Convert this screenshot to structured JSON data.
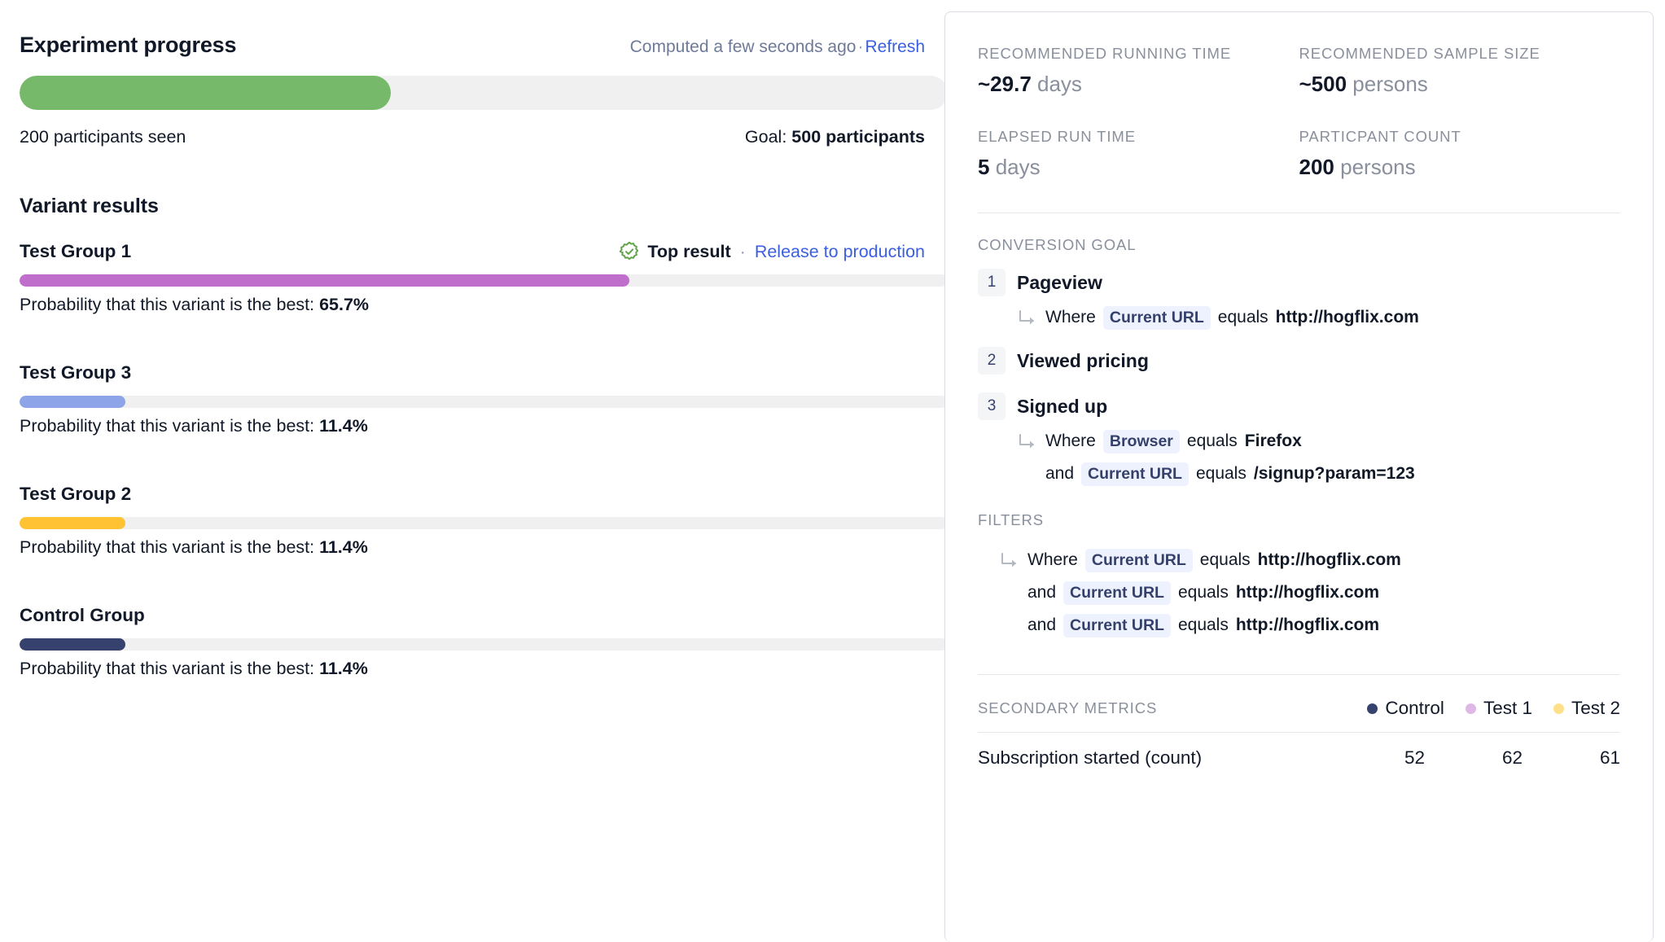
{
  "left": {
    "progress_title": "Experiment progress",
    "computed_text": "Computed a few seconds ago",
    "separator": "·",
    "refresh_label": "Refresh",
    "progress_percent": 40,
    "progress_color": "#77b96b",
    "participants_seen": "200 participants seen",
    "goal_prefix": "Goal: ",
    "goal_value": "500 participants",
    "variant_results_title": "Variant results",
    "top_result_label": "Top result",
    "top_result_separator": "·",
    "release_label": "Release to production",
    "prob_prefix": "Probability that this variant is the best: ",
    "variants": [
      {
        "name": "Test Group 1",
        "probability": "65.7%",
        "percent": 65.7,
        "color": "#bf6ecb",
        "top": true
      },
      {
        "name": "Test Group 3",
        "probability": "11.4%",
        "percent": 11.4,
        "color": "#8da5e8",
        "top": false
      },
      {
        "name": "Test Group 2",
        "probability": "11.4%",
        "percent": 11.4,
        "color": "#ffc233",
        "top": false
      },
      {
        "name": "Control Group",
        "probability": "11.4%",
        "percent": 11.4,
        "color": "#36416e",
        "top": false
      }
    ]
  },
  "right": {
    "metrics": [
      {
        "label": "Recommended running time",
        "value": "~29.7",
        "unit": "days"
      },
      {
        "label": "Recommended sample size",
        "value": "~500",
        "unit": "persons"
      },
      {
        "label": "Elapsed run time",
        "value": "5",
        "unit": "days"
      },
      {
        "label": "Particpant count",
        "value": "200",
        "unit": "persons"
      }
    ],
    "conversion_goal_label": "Conversion goal",
    "steps": [
      {
        "number": "1",
        "name": "Pageview",
        "conditions": [
          {
            "prefix": "Where",
            "property": "Current URL",
            "operator": "equals",
            "value": "http://hogflix.com",
            "first": true
          }
        ]
      },
      {
        "number": "2",
        "name": "Viewed pricing",
        "conditions": []
      },
      {
        "number": "3",
        "name": "Signed up",
        "conditions": [
          {
            "prefix": "Where",
            "property": "Browser",
            "operator": "equals",
            "value": "Firefox",
            "first": true
          },
          {
            "prefix": "and",
            "property": "Current URL",
            "operator": "equals",
            "value": "/signup?param=123",
            "first": false
          }
        ]
      }
    ],
    "filters_label": "Filters",
    "filters": [
      {
        "prefix": "Where",
        "property": "Current URL",
        "operator": "equals",
        "value": "http://hogflix.com",
        "first": true
      },
      {
        "prefix": "and",
        "property": "Current URL",
        "operator": "equals",
        "value": "http://hogflix.com",
        "first": false
      },
      {
        "prefix": "and",
        "property": "Current URL",
        "operator": "equals",
        "value": "http://hogflix.com",
        "first": false
      }
    ],
    "secondary_metrics_label": "Secondary metrics",
    "legend": [
      {
        "label": "Control",
        "color": "#36416e"
      },
      {
        "label": "Test 1",
        "color": "#dfb8e8"
      },
      {
        "label": "Test 2",
        "color": "#ffe08a"
      }
    ],
    "table_rows": [
      {
        "name": "Subscription started (count)",
        "values": [
          "52",
          "62",
          "61"
        ]
      }
    ]
  }
}
